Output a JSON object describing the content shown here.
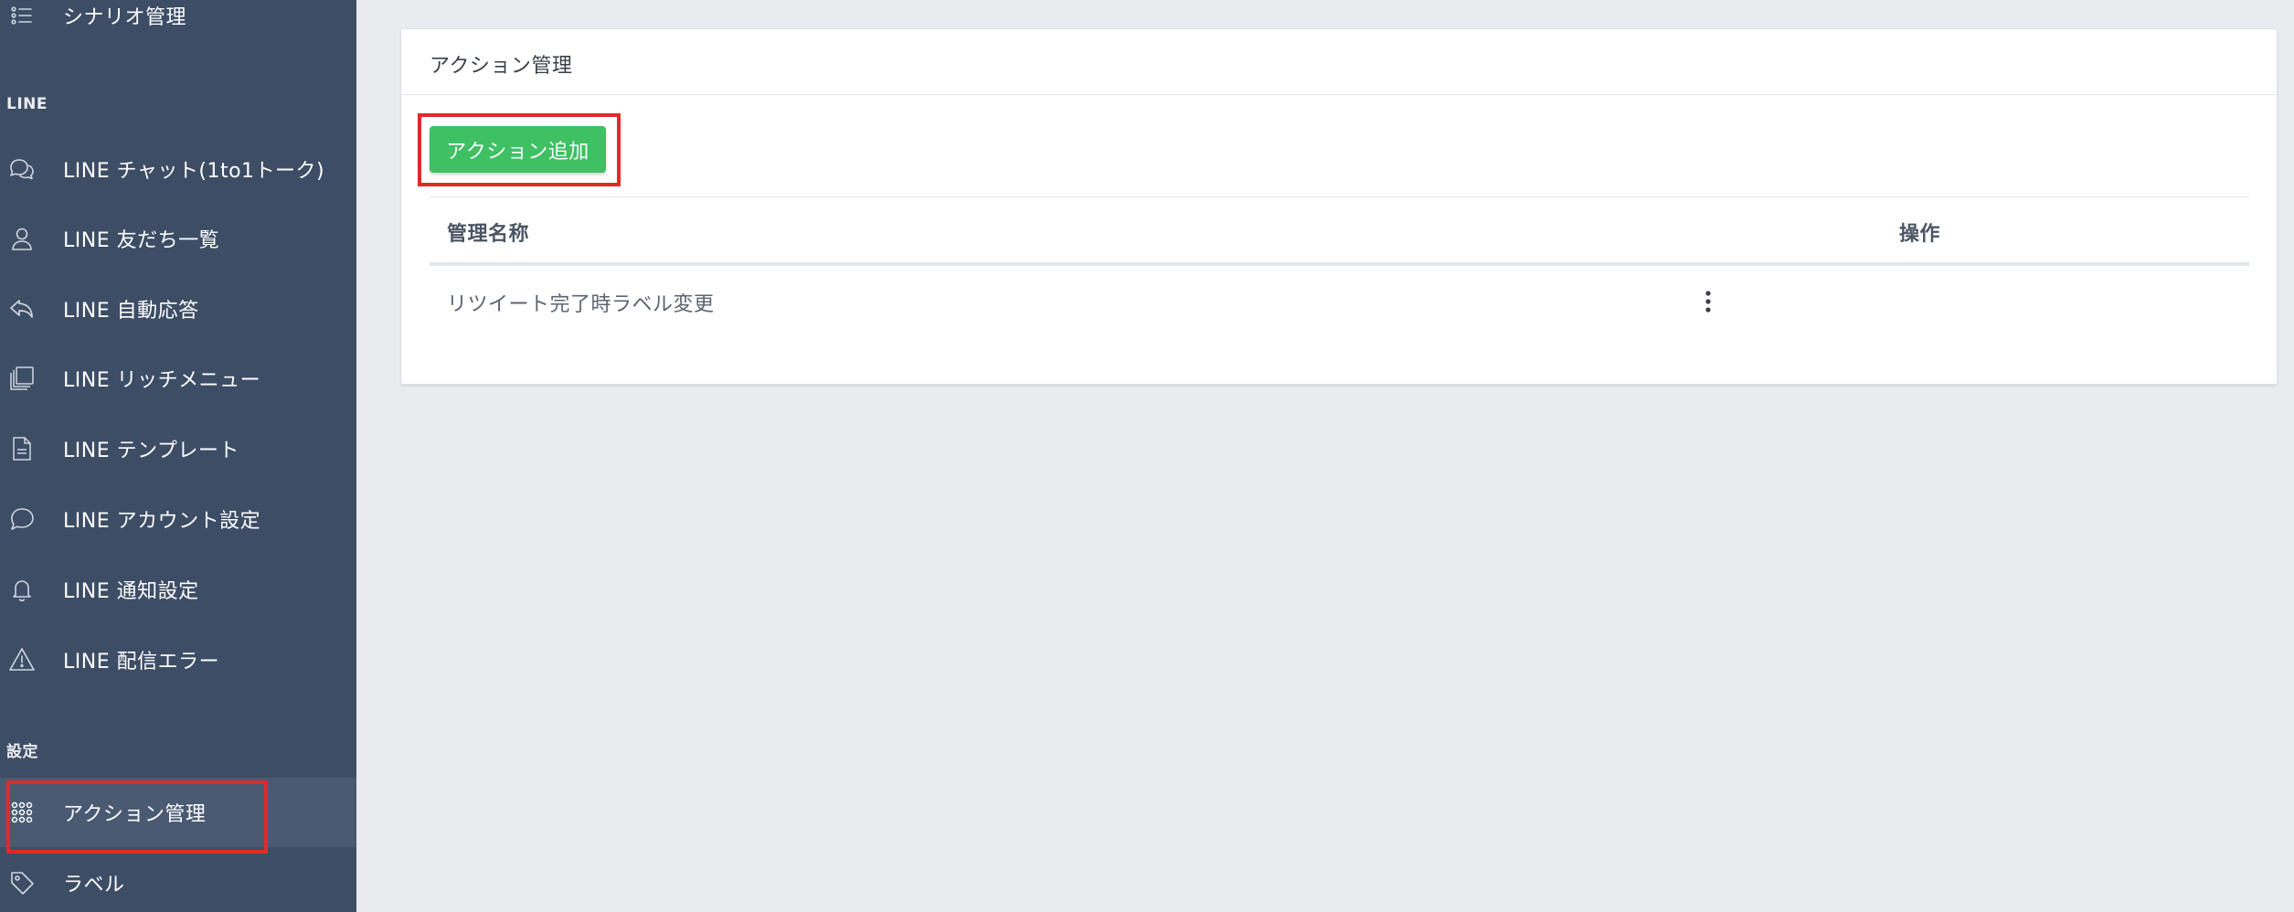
{
  "sidebar": {
    "top_item": {
      "label": "シナリオ管理",
      "icon": "list-icon"
    },
    "sections": [
      {
        "label": "LINE"
      },
      {
        "label": "設定"
      }
    ],
    "line_items": [
      {
        "label": "LINE チャット(1to1トーク)",
        "icon": "chat-bubbles-icon"
      },
      {
        "label": "LINE 友だち一覧",
        "icon": "user-icon"
      },
      {
        "label": "LINE 自動応答",
        "icon": "reply-icon"
      },
      {
        "label": "LINE リッチメニュー",
        "icon": "layers-icon"
      },
      {
        "label": "LINE テンプレート",
        "icon": "document-icon"
      },
      {
        "label": "LINE アカウント設定",
        "icon": "speech-bubble-icon"
      },
      {
        "label": "LINE 通知設定",
        "icon": "bell-icon"
      },
      {
        "label": "LINE 配信エラー",
        "icon": "warning-icon"
      }
    ],
    "settings_items": [
      {
        "label": "アクション管理",
        "icon": "grid-dots-icon",
        "active": true
      },
      {
        "label": "ラベル",
        "icon": "tag-icon"
      }
    ]
  },
  "main": {
    "card_title": "アクション管理",
    "add_button_label": "アクション追加",
    "table": {
      "columns": [
        "管理名称",
        "操作"
      ],
      "rows": [
        {
          "name": "リツイート完了時ラベル変更",
          "action_icon": "kebab-menu-icon"
        }
      ]
    }
  },
  "colors": {
    "sidebar_bg": "#3d4d66",
    "sidebar_active_bg": "#4a5a73",
    "page_bg": "#e9ebee",
    "accent_green": "#3ec063",
    "highlight_red": "#e02a2a"
  }
}
